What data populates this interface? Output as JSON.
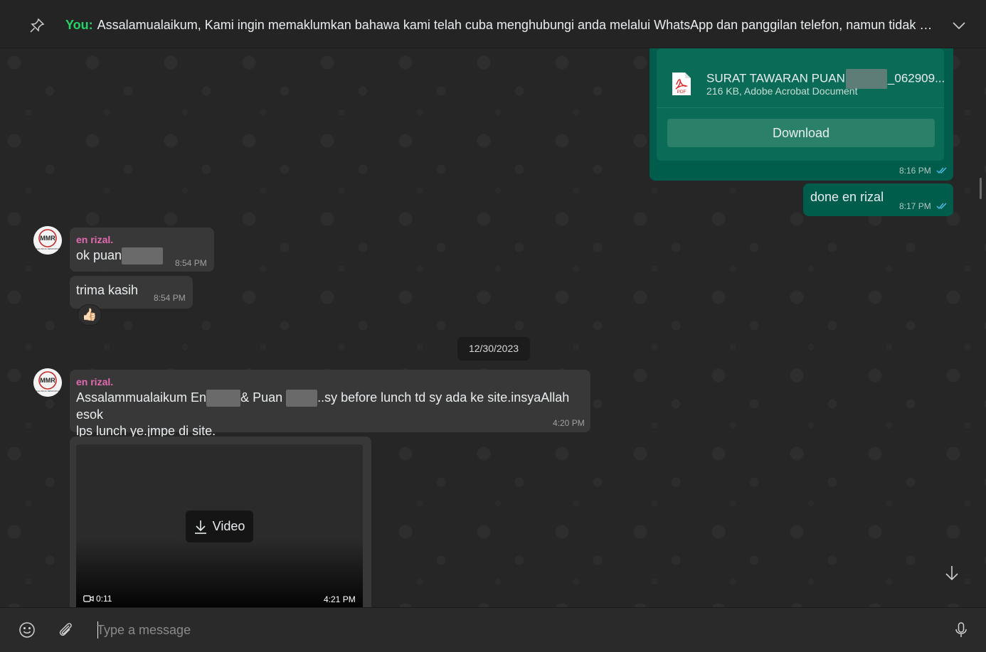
{
  "pinned": {
    "sender": "You:",
    "text": "Assalamualaikum,  Kami ingin memaklumkan bahawa kami telah cuba menghubungi anda melalui WhatsApp dan panggilan telefon, namun tidak mener..."
  },
  "document": {
    "name_start": "SURAT TAWARAN PUAN",
    "name_end": "_062909...",
    "meta": "216 KB, Adobe Acrobat Document",
    "icon_label": "PDF",
    "download_label": "Download",
    "time": "8:16 PM"
  },
  "messages": [
    {
      "text": "done en rizal",
      "time": "8:17 PM"
    },
    {
      "sender": "en rizal.",
      "text": "ok puan",
      "time": "8:54 PM"
    },
    {
      "text": "trima kasih",
      "time": "8:54 PM",
      "reaction": "👍🏻"
    },
    {
      "sender": "en rizal.",
      "part1": "Assalammualaikum En",
      "part2": "& Puan ",
      "part3": "..sy before lunch td sy ada ke site.insyaAllah esok",
      "part4": "lps lunch ye.jmpe di site.",
      "time": "4:20 PM"
    }
  ],
  "date_separator": "12/30/2023",
  "avatar": {
    "text": "MMR",
    "caption": "MEGA MAJU RESOURCES"
  },
  "video": {
    "label": "Video",
    "duration": "0:11",
    "time": "4:21 PM"
  },
  "composer": {
    "placeholder": "Type a message"
  },
  "colors": {
    "outgoing": "#005c4b",
    "incoming": "#383838",
    "sender_name": "#e26ab1",
    "accent": "#25d366",
    "read_ticks": "#53bdeb"
  }
}
